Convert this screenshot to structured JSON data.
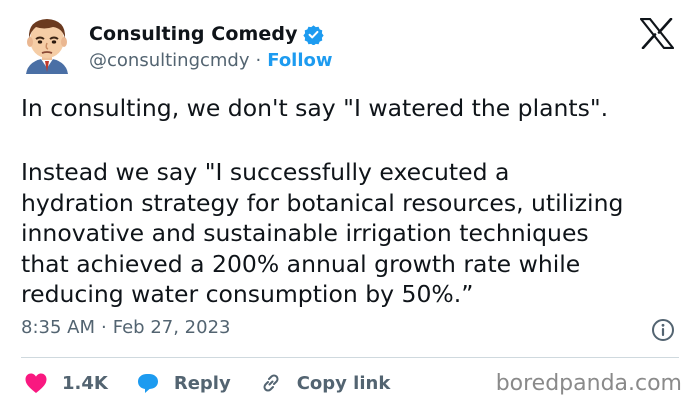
{
  "author": {
    "display_name": "Consulting Comedy",
    "handle": "@consultingcmdy",
    "separator": "·",
    "follow_label": "Follow",
    "avatar_icon": "cartoon-avatar-icon",
    "verified_icon": "verified-badge-icon",
    "verified_color": "#1d9bf0"
  },
  "brand_icon": "x-logo-icon",
  "tweet": {
    "line1": "In consulting, we don't say \"I watered the plants\".",
    "para2": [
      "Instead we say \"I successfully executed a",
      "hydration strategy for botanical resources, utilizing",
      "innovative and sustainable irrigation techniques",
      "that achieved a 200% annual growth rate while",
      "reducing water consumption by 50%.”"
    ]
  },
  "meta": {
    "time": "8:35 AM",
    "separator": "·",
    "date": "Feb 27, 2023",
    "info_icon": "info-icon"
  },
  "actions": {
    "like_count": "1.4K",
    "like_icon": "heart-icon",
    "like_color": "#f91880",
    "reply_label": "Reply",
    "reply_icon": "reply-bubble-icon",
    "reply_color": "#1d9bf0",
    "copy_label": "Copy link",
    "copy_icon": "link-icon"
  },
  "watermark": "boredpanda.com"
}
